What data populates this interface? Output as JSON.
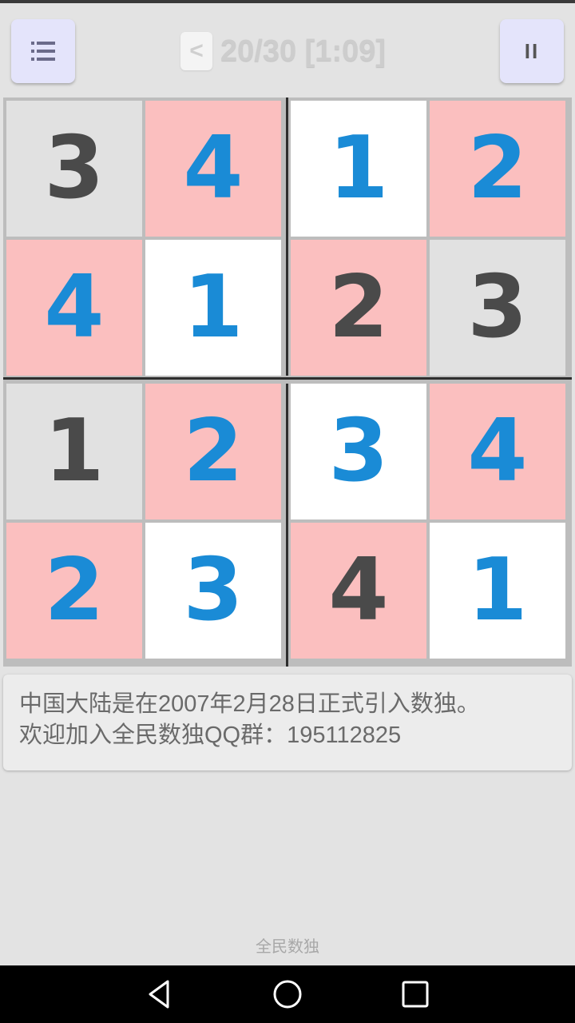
{
  "header": {
    "menu_icon": "list-icon",
    "back_label": "<",
    "progress": "20/30 [1:09]",
    "pause_label": "II"
  },
  "board": {
    "rows": [
      [
        {
          "v": "3",
          "bg": "gray",
          "kind": "given"
        },
        {
          "v": "4",
          "bg": "pink",
          "kind": "user"
        },
        {
          "v": "1",
          "bg": "white",
          "kind": "user"
        },
        {
          "v": "2",
          "bg": "pink",
          "kind": "user"
        }
      ],
      [
        {
          "v": "4",
          "bg": "pink",
          "kind": "user"
        },
        {
          "v": "1",
          "bg": "white",
          "kind": "user"
        },
        {
          "v": "2",
          "bg": "pink",
          "kind": "given"
        },
        {
          "v": "3",
          "bg": "gray",
          "kind": "given"
        }
      ],
      [
        {
          "v": "1",
          "bg": "gray",
          "kind": "given"
        },
        {
          "v": "2",
          "bg": "pink",
          "kind": "user"
        },
        {
          "v": "3",
          "bg": "white",
          "kind": "user"
        },
        {
          "v": "4",
          "bg": "pink",
          "kind": "user"
        }
      ],
      [
        {
          "v": "2",
          "bg": "pink",
          "kind": "user"
        },
        {
          "v": "3",
          "bg": "white",
          "kind": "user"
        },
        {
          "v": "4",
          "bg": "pink",
          "kind": "given"
        },
        {
          "v": "1",
          "bg": "white",
          "kind": "user"
        }
      ]
    ]
  },
  "info": {
    "line1": "中国大陆是在2007年2月28日正式引入数独。",
    "line2": "欢迎加入全民数独QQ群：195112825"
  },
  "footer": {
    "app_name": "全民数独"
  },
  "nav": {
    "back_icon": "triangle-back-icon",
    "home_icon": "circle-home-icon",
    "recents_icon": "square-recents-icon"
  },
  "colors": {
    "given_number": "#4a4a4a",
    "user_number": "#1a8bd6",
    "cell_gray": "#e1e1e1",
    "cell_pink": "#fbbfbf",
    "cell_white": "#ffffff",
    "button_bg": "#e4e4fb"
  }
}
